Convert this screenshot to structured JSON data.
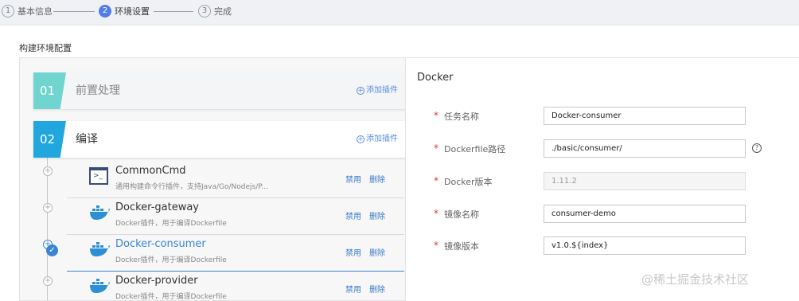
{
  "steps": [
    {
      "num": "1",
      "label": "基本信息"
    },
    {
      "num": "2",
      "label": "环境设置"
    },
    {
      "num": "3",
      "label": "完成"
    }
  ],
  "section_title": "构建环境配置",
  "stages": [
    {
      "num": "01",
      "title": "前置处理",
      "add_label": "添加插件"
    },
    {
      "num": "02",
      "title": "编译",
      "add_label": "添加插件"
    }
  ],
  "plugins": [
    {
      "name": "CommonCmd",
      "desc": "通用构建命令行插件，支持Java/Go/Nodejs/P...",
      "icon": "terminal-icon",
      "disable": "禁用",
      "delete": "删除"
    },
    {
      "name": "Docker-gateway",
      "desc": "Docker插件，用于编译Dockerfile",
      "icon": "docker-icon",
      "disable": "禁用",
      "delete": "删除"
    },
    {
      "name": "Docker-consumer",
      "desc": "Docker插件，用于编译Dockerfile",
      "icon": "docker-icon",
      "disable": "禁用",
      "delete": "删除"
    },
    {
      "name": "Docker-provider",
      "desc": "Docker插件，用于编译Dockerfile",
      "icon": "docker-icon",
      "disable": "禁用",
      "delete": "删除"
    }
  ],
  "panel": {
    "title": "Docker",
    "fields": [
      {
        "label": "任务名称",
        "value": "Docker-consumer"
      },
      {
        "label": "Dockerfile路径",
        "value": "./basic/consumer/"
      },
      {
        "label": "Docker版本",
        "value": "1.11.2"
      },
      {
        "label": "镜像名称",
        "value": "consumer-demo"
      },
      {
        "label": "镜像版本",
        "value": "v1.0.${index}"
      }
    ]
  },
  "watermark": "@稀土掘金技术社区",
  "colors": {
    "accent": "#3a83d6",
    "stage1": "#70d4cf",
    "stage2": "#21a7de",
    "required": "#e2362b"
  }
}
